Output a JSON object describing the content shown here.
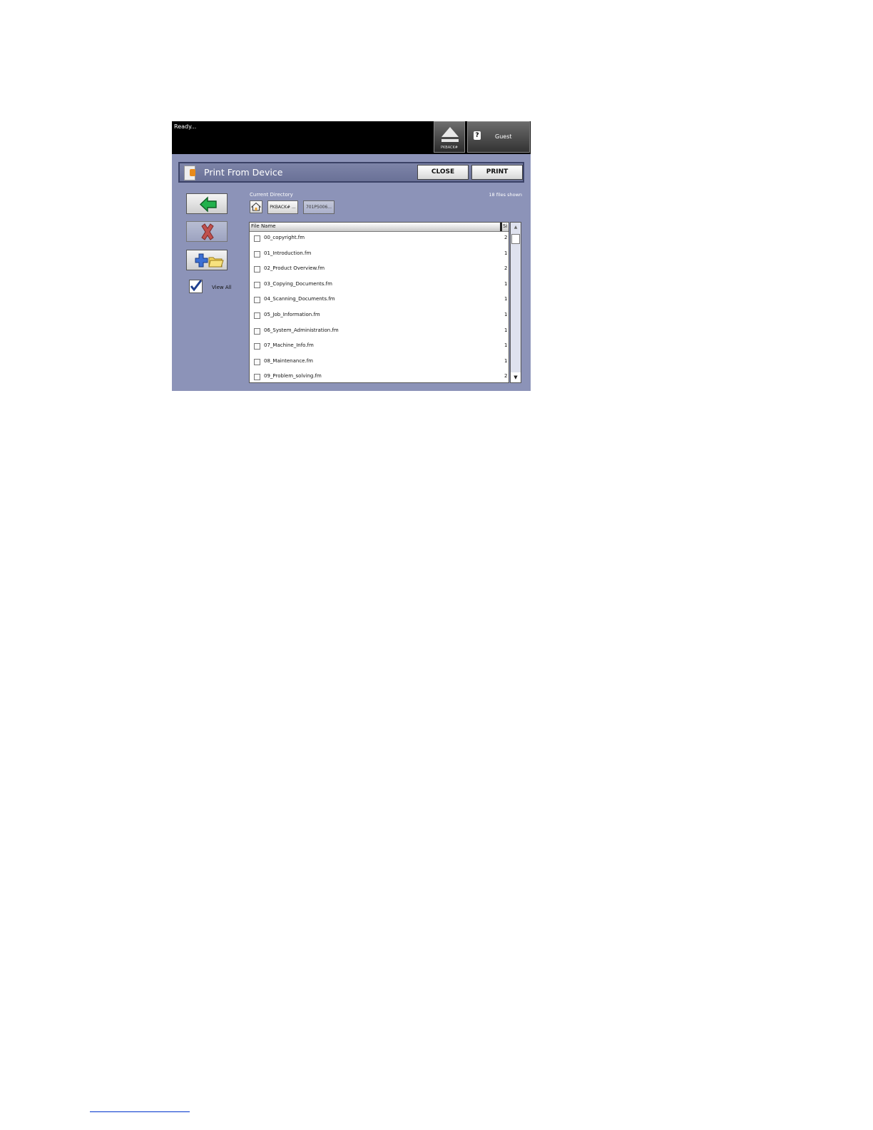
{
  "topbar": {
    "status": "Ready...",
    "eject_label": "PKBACK#",
    "user_label": "Guest",
    "user_icon_glyph": "?"
  },
  "titlebar": {
    "title": "Print From Device",
    "close_label": "CLOSE",
    "print_label": "PRINT"
  },
  "sidebar": {
    "view_all_label": "View All",
    "view_all_checked": true
  },
  "directory": {
    "label": "Current Directory",
    "files_shown": "18 files shown",
    "path": [
      "PKBACK# ...",
      "701P5006..."
    ]
  },
  "filelist": {
    "columns": [
      "File Name",
      "Si"
    ],
    "rows": [
      {
        "name": "00_copyright.fm",
        "size": "2"
      },
      {
        "name": "01_Introduction.fm",
        "size": "1"
      },
      {
        "name": "02_Product Overview.fm",
        "size": "2"
      },
      {
        "name": "03_Copying_Documents.fm",
        "size": "1"
      },
      {
        "name": "04_Scanning_Documents.fm",
        "size": "1"
      },
      {
        "name": "05_Job_Information.fm",
        "size": "1"
      },
      {
        "name": "06_System_Administration.fm",
        "size": "1"
      },
      {
        "name": "07_Machine_Info.fm",
        "size": "1"
      },
      {
        "name": "08_Maintenance.fm",
        "size": "1"
      },
      {
        "name": "09_Problem_solving.fm",
        "size": "2"
      }
    ]
  }
}
